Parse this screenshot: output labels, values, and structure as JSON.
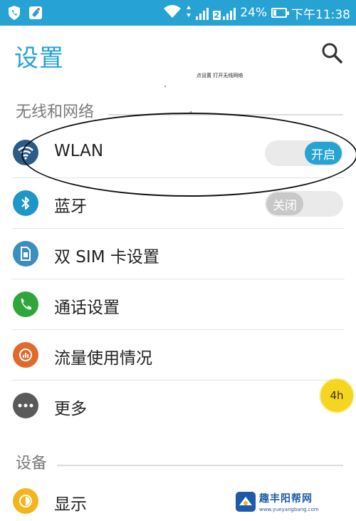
{
  "status_bar": {
    "battery_percent": "24%",
    "time": "下午11:38",
    "sim2_number": "2",
    "battery_level": 0.24
  },
  "header": {
    "title": "设置"
  },
  "caption": "点设置 打开无线网络",
  "sections": {
    "wireless": "无线和网络",
    "device": "设备"
  },
  "rows": {
    "wlan": {
      "label": "WLAN",
      "toggle": "开启",
      "icon": "wifi-icon",
      "color": "#2a5c8a"
    },
    "bluetooth": {
      "label": "蓝牙",
      "toggle": "关闭",
      "icon": "bluetooth-icon",
      "color": "#1e96c8"
    },
    "dual_sim": {
      "label": "双 SIM 卡设置",
      "icon": "sim-card-icon",
      "color": "#3a8fc0"
    },
    "call": {
      "label": "通话设置",
      "icon": "phone-icon",
      "color": "#2ea63a"
    },
    "data_usage": {
      "label": "流量使用情况",
      "icon": "data-usage-icon",
      "color": "#e06a2b"
    },
    "more": {
      "label": "更多",
      "icon": "more-icon",
      "color": "#5a5a5a"
    },
    "display": {
      "label": "显示",
      "icon": "brightness-icon",
      "color": "#f3b51b"
    }
  },
  "floating_badge": "4h",
  "watermark": {
    "text": "趣丰阳帮网",
    "url": "www.yueyangbang.com"
  },
  "colors": {
    "accent": "#26a3d2",
    "toggle_on": "#26a3d2",
    "toggle_off": "#c8c8c8"
  }
}
